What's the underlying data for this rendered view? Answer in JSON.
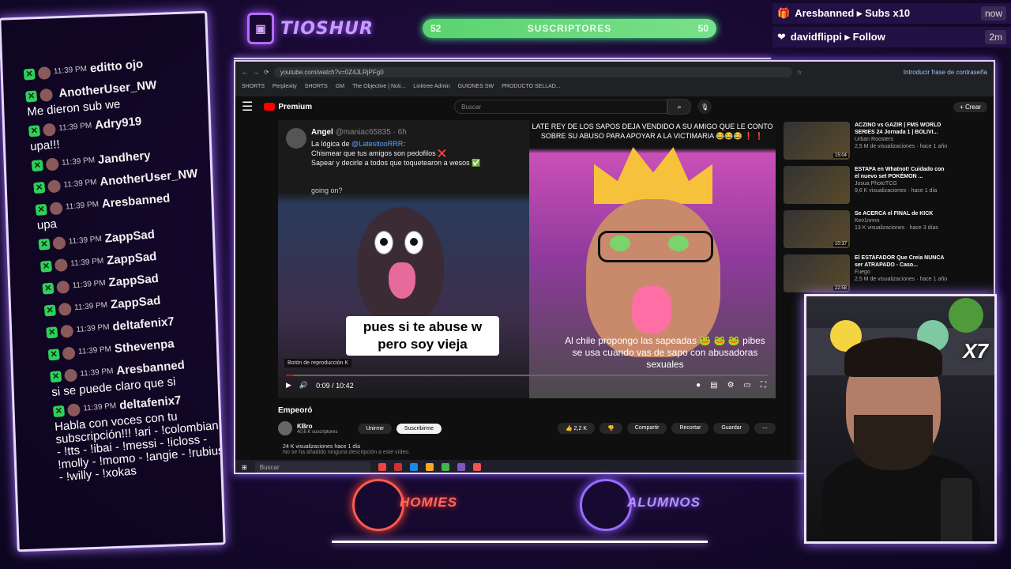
{
  "header": {
    "logo_text": "TIOSHUR",
    "subs": {
      "left": "52",
      "label": "SUSCRIPTORES",
      "right": "50",
      "fill": 1.04
    }
  },
  "events": [
    {
      "text": "Aresbanned ▸ Subs x10",
      "time": "now",
      "icon": "gift-icon"
    },
    {
      "text": "davidflippi ▸ Follow",
      "time": "2m",
      "icon": "heart-icon"
    }
  ],
  "chat": [
    {
      "time": "11:39 PM",
      "user": "editto ojo",
      "text": ""
    },
    {
      "time": "",
      "user": "AnotherUser_NW",
      "text": "Me dieron sub we"
    },
    {
      "time": "11:39 PM",
      "user": "Adry919",
      "text": "upa!!!"
    },
    {
      "time": "11:39 PM",
      "user": "Jandhery",
      "text": ""
    },
    {
      "time": "11:39 PM",
      "user": "AnotherUser_NW",
      "text": ""
    },
    {
      "time": "11:39 PM",
      "user": "Aresbanned",
      "text": "upa"
    },
    {
      "time": "11:39 PM",
      "user": "ZappSad",
      "text": ""
    },
    {
      "time": "11:39 PM",
      "user": "ZappSad",
      "text": ""
    },
    {
      "time": "11:39 PM",
      "user": "ZappSad",
      "text": ""
    },
    {
      "time": "11:39 PM",
      "user": "ZappSad",
      "text": ""
    },
    {
      "time": "11:39 PM",
      "user": "deltafenix7",
      "text": ""
    },
    {
      "time": "11:39 PM",
      "user": "Sthevenpa",
      "text": ""
    },
    {
      "time": "11:39 PM",
      "user": "Aresbanned",
      "text": "si se puede claro que si"
    },
    {
      "time": "11:39 PM",
      "user": "deltafenix7",
      "text": "Habla con voces con tu subscripción!!! !ari - !colombiana - !tts - !ibai - !messi - !icloss - !molly - !momo - !angie - !rubius - !willy - !xokas"
    }
  ],
  "browser": {
    "url": "youtube.com/watch?v=0Z4JLRjPFg0",
    "password_hint": "Introducir frase de contraseña",
    "bookmarks": [
      "SHORTS",
      "Perplexity",
      "SHORTS",
      "GM",
      "The Objective | Noti...",
      "Linktree Admin",
      "GUIONES SW",
      "PRODUCTO SELLAD..."
    ],
    "yt_brand": "Premium",
    "search_placeholder": "Buscar",
    "create_label": "+ Crear"
  },
  "video": {
    "tweet_name": "Angel",
    "tweet_handle": "@maniac65835 · 6h",
    "tweet_line1_prefix": "La lógica de ",
    "tweet_mention": "@LatesitooRRR",
    "tweet_line1_suffix": ":",
    "tweet_line2": "Chismear que tus amigos son pedofilos ❌",
    "tweet_line3": "Sapear y decirle a todos que toquetearon a wesos ✅",
    "left_partial": "going on?",
    "caption_left": "pues si te abuse w pero soy vieja",
    "right_title": "LATE REY DE LOS SAPOS DEJA VENDIDO A SU AMIGO QUE LE CONTO SOBRE SU ABUSO PARA APOYAR A LA VICTIMARIA 😂😂😂 ❗ ❗",
    "subtitle": "Al chile propongo las sapeadas 🐸 🐸 🐸 pibes se usa cuando vas de sapo con abusadoras sexuales",
    "tooltip": "Botón de reproducción  K",
    "time": "0:09 / 10:42",
    "progress": 0.014
  },
  "meta": {
    "title": "Empeoró",
    "channel": "KBro",
    "subs": "40,6 K suscriptores",
    "join": "Unirme",
    "subscribe": "Suscribirme",
    "likes": "2,2 K",
    "share": "Compartir",
    "clip": "Recortar",
    "save": "Guardar",
    "desc1": "24 K visualizaciones  hace 1 día",
    "desc2": "No se ha añadido ninguna descripción a este vídeo."
  },
  "recs": [
    {
      "title": "ACZINO vs GAZIR | FMS WORLD SERIES 24 Jornada 1 | BOLIVI...",
      "channel": "Urban Roosters",
      "meta": "2,5 M de visualizaciones · hace 1 año",
      "dur": "15:04"
    },
    {
      "title": "ESTAFA en Whatnot! Cuidado con el nuevo set POKÉMON ...",
      "channel": "Josua PhotoTCG",
      "meta": "9,6 K visualizaciones · hace 1 día",
      "dur": ""
    },
    {
      "title": "Se ACERCA el FINAL de KICK",
      "channel": "Kev1nnnn",
      "meta": "13 K visualizaciones · hace 3 días",
      "dur": "10:37"
    },
    {
      "title": "El ESTAFADOR Que Creía NUNCA ser ATRAPADO - Caso...",
      "channel": "Fuego",
      "meta": "2,5 M de visualizaciones · hace 1 año",
      "dur": "22:58"
    }
  ],
  "taskbar": {
    "search": "Buscar"
  },
  "bottom": {
    "homies": "HOMIES",
    "alumnos": "ALUMNOS"
  },
  "cam": {
    "badge": "X7"
  }
}
